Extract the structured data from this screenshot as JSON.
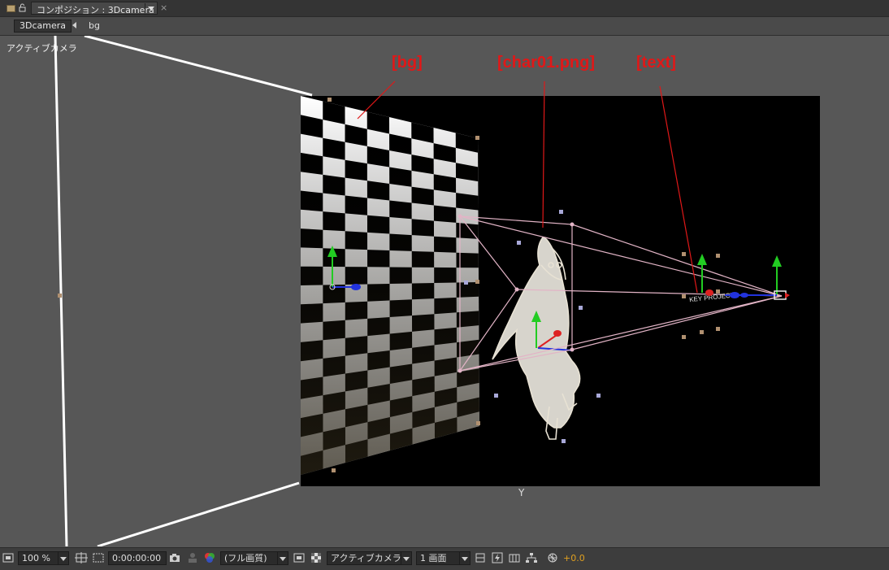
{
  "panel": {
    "tab_label": "コンポジション : 3Dcamera",
    "close_glyph": "×"
  },
  "breadcrumb": {
    "composition": "3Dcamera",
    "layer": "bg"
  },
  "viewer": {
    "view_label": "アクティブカメラ",
    "callouts": {
      "bg": "[bg]",
      "char": "[char01.png]",
      "text": "[text]"
    },
    "text_layer_content": "KEY PROJECT"
  },
  "toolbar": {
    "zoom": "100 %",
    "timecode": "0:00:00:00",
    "resolution": "(フル画質)",
    "camera_view": "アクティブカメラ",
    "view_layout": "1 画面",
    "exposure": "+0.0"
  },
  "icons": {
    "lock": "lock-icon",
    "panel": "panel-menu-icon",
    "camera": "snapshot-camera-icon",
    "color": "rgb-channel-icon"
  },
  "colors": {
    "callout": "#e01818",
    "y_axis": "#22cc22",
    "x_axis": "#dd2222",
    "z_axis": "#2233dd",
    "exposure": "#e0a020"
  }
}
